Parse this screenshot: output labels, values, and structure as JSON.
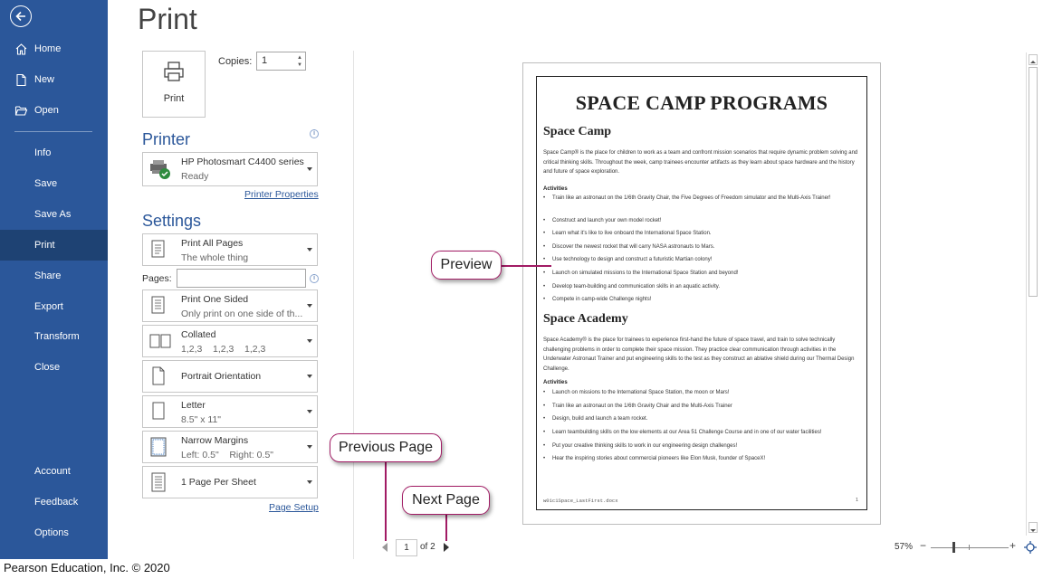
{
  "sidebar": {
    "items": [
      {
        "label": "Home"
      },
      {
        "label": "New"
      },
      {
        "label": "Open"
      },
      {
        "label": "Info"
      },
      {
        "label": "Save"
      },
      {
        "label": "Save As"
      },
      {
        "label": "Print"
      },
      {
        "label": "Share"
      },
      {
        "label": "Export"
      },
      {
        "label": "Transform"
      },
      {
        "label": "Close"
      }
    ],
    "bottom_items": [
      {
        "label": "Account"
      },
      {
        "label": "Feedback"
      },
      {
        "label": "Options"
      }
    ],
    "active": "Print",
    "colors": {
      "bg": "#2b579a",
      "active": "#1e4273"
    }
  },
  "page_title": "Print",
  "print_button_label": "Print",
  "copies": {
    "label": "Copies:",
    "value": "1"
  },
  "printer": {
    "heading": "Printer",
    "name": "HP Photosmart C4400 series",
    "status": "Ready",
    "properties_link": "Printer Properties"
  },
  "settings": {
    "heading": "Settings",
    "print_range": {
      "title": "Print All Pages",
      "subtitle": "The whole thing"
    },
    "pages_label": "Pages:",
    "pages_value": "",
    "sides": {
      "title": "Print One Sided",
      "subtitle": "Only print on one side of th..."
    },
    "collation": {
      "title": "Collated",
      "subtitle": "1,2,3    1,2,3    1,2,3"
    },
    "orientation": {
      "title": "Portrait Orientation"
    },
    "paper_size": {
      "title": "Letter",
      "subtitle": "8.5\" x 11\""
    },
    "margins": {
      "title": "Narrow Margins",
      "subtitle": "Left: 0.5\"    Right: 0.5\""
    },
    "per_sheet": {
      "title": "1 Page Per Sheet"
    },
    "page_setup_link": "Page Setup"
  },
  "preview_doc": {
    "title": "SPACE CAMP PROGRAMS",
    "sections": [
      {
        "heading": "Space Camp",
        "paragraph": "Space Camp® is the place for children to work as a team and confront mission scenarios that require dynamic problem solving and critical thinking skills. Throughout the week, camp trainees encounter artifacts as they learn about space hardware and the history and future of space exploration.",
        "activities_label": "Activities",
        "bullets": [
          "Train like an astronaut on the 1/6th Gravity Chair, the Five Degrees of Freedom simulator and the Multi-Axis Trainer!",
          "Construct and launch your own model rocket!",
          "Learn what it's like to live onboard the International Space Station.",
          "Discover the newest rocket that will carry NASA astronauts to Mars.",
          "Use technology to design and construct a futuristic Martian colony!",
          "Launch on simulated missions to the International Space Station and beyond!",
          "Develop team-building and communication skills in an aquatic activity.",
          "Compete in camp-wide Challenge nights!"
        ]
      },
      {
        "heading": "Space Academy",
        "paragraph": "Space Academy® is the place for trainees to experience first-hand the future of space travel, and train to solve technically challenging problems in order to complete their space mission. They practice clear communication through activities in the Underwater Astronaut Trainer and put engineering skills to the test as they construct an ablative shield during our Thermal Design Challenge.",
        "activities_label": "Activities",
        "bullets": [
          "Launch on missions to the International Space Station, the moon or Mars!",
          "Train like an astronaut on the 1/6th Gravity Chair and the Multi-Axis Trainer",
          "Design, build and launch a team rocket.",
          "Learn teambuilding skills on the low elements at our Area 51 Challenge Course and in one of our water facilities!",
          "Put your creative thinking skills to work in our engineering design challenges!",
          "Hear the inspiring stories about commercial pioneers like Elon Musk, founder of SpaceX!"
        ]
      }
    ],
    "footer_file": "w01c1Space_LastFirst.docx",
    "footer_page": "1"
  },
  "callouts": {
    "preview": "Preview",
    "previous_page": "Previous Page",
    "next_page": "Next Page",
    "color": "#a11b64"
  },
  "page_nav": {
    "current": "1",
    "of": "of 2"
  },
  "zoom": {
    "percent": "57%",
    "minus": "−",
    "plus": "+"
  },
  "copyright": "Pearson Education, Inc. © 2020"
}
